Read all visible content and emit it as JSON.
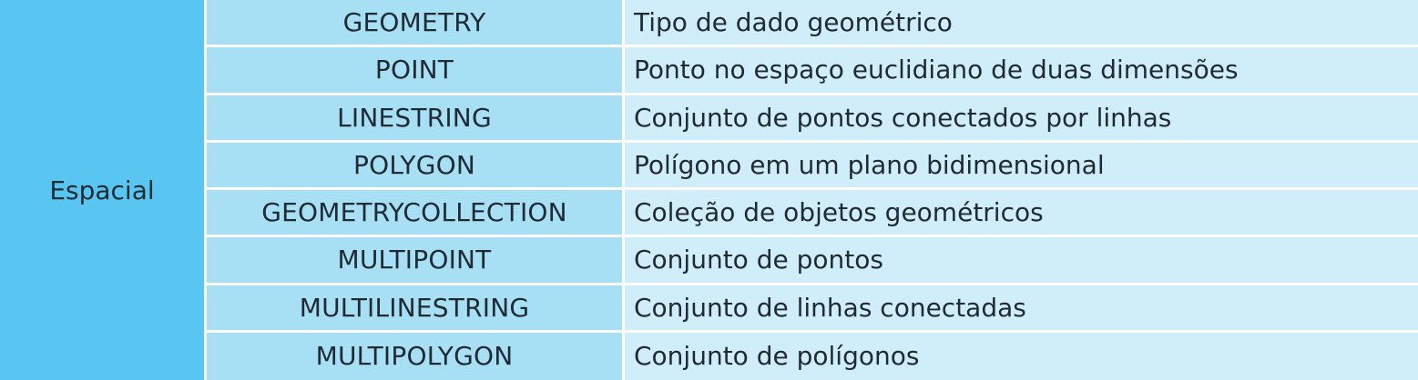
{
  "table": {
    "category": "Espacial",
    "rows": [
      {
        "type": "GEOMETRY",
        "description": "Tipo de dado geométrico"
      },
      {
        "type": "POINT",
        "description": "Ponto no espaço euclidiano de duas dimensões"
      },
      {
        "type": "LINESTRING",
        "description": "Conjunto de pontos conectados por linhas"
      },
      {
        "type": "POLYGON",
        "description": "Polígono em um plano bidimensional"
      },
      {
        "type": "GEOMETRYCOLLECTION",
        "description": "Coleção de objetos geométricos"
      },
      {
        "type": "MULTIPOINT",
        "description": "Conjunto de pontos"
      },
      {
        "type": "MULTILINESTRING",
        "description": "Conjunto de linhas conectadas"
      },
      {
        "type": "MULTIPOLYGON",
        "description": "Conjunto de polígonos"
      }
    ]
  },
  "colors": {
    "category_bg": "#59c5f1",
    "type_bg": "#a7dff5",
    "description_bg": "#cfeefa",
    "divider": "#ffffff"
  }
}
